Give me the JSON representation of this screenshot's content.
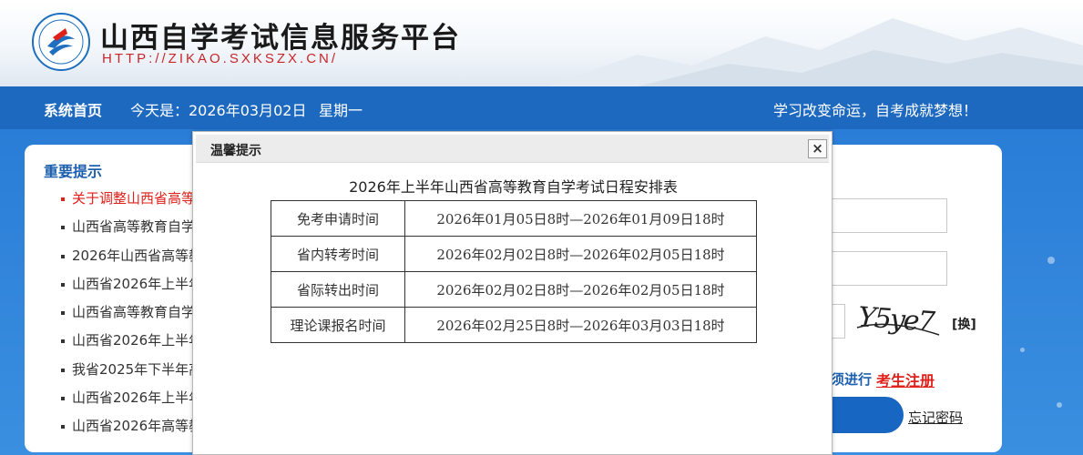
{
  "header": {
    "site_title": "山西自学考试信息服务平台",
    "site_url": "HTTP://ZIKAO.SXKSZX.CN/"
  },
  "nav": {
    "home": "系统首页",
    "today": "今天是：2026年03月02日",
    "weekday": "星期一",
    "slogan": "学习改变命运，自考成就梦想！"
  },
  "notices": {
    "title": "重要提示",
    "items": [
      "关于调整山西省高等",
      "山西省高等教育自学",
      "2026年山西省高等教",
      "山西省2026年上半年",
      "山西省高等教育自学",
      "山西省2026年上半年",
      "我省2025年下半年高",
      "山西省2026年上半年",
      "山西省2026年高等教"
    ]
  },
  "login": {
    "captcha_text": "Y5ye7",
    "refresh": "[换]",
    "register_prefix": "须进行",
    "register_link": "考生注册",
    "forgot": "忘记密码"
  },
  "modal": {
    "title": "温馨提示",
    "close": "×",
    "table_title": "2026年上半年山西省高等教育自学考试日程安排表",
    "rows": [
      {
        "label": "免考申请时间",
        "time": "2026年01月05日8时—2026年01月09日18时"
      },
      {
        "label": "省内转考时间",
        "time": "2026年02月02日8时—2026年02月05日18时"
      },
      {
        "label": "省际转出时间",
        "time": "2026年02月02日8时—2026年02月05日18时"
      },
      {
        "label": "理论课报名时间",
        "time": "2026年02月25日8时—2026年03月03日18时"
      }
    ]
  },
  "colors": {
    "nav_blue": "#1e69c0",
    "accent_red": "#e0201b",
    "title_blue": "#1d5fae"
  }
}
